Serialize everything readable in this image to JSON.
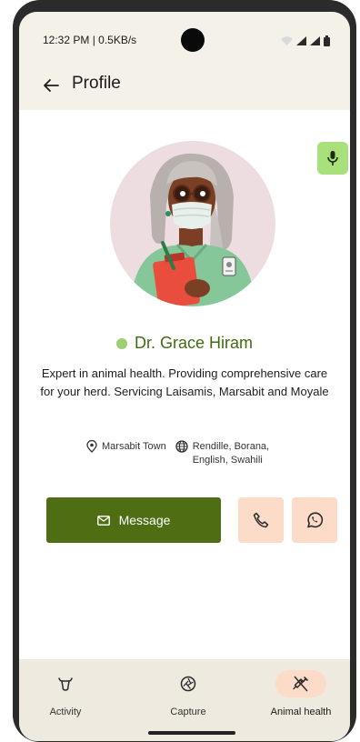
{
  "status_bar": {
    "time_speed": "12:32 PM | 0.5KB/s",
    "icons": [
      "wifi-icon",
      "signal-icon",
      "signal-icon",
      "battery-icon"
    ]
  },
  "app_bar": {
    "back_icon": "arrow-left-icon",
    "title": "Profile"
  },
  "profile": {
    "mic_icon": "microphone-icon",
    "avatar_icon": "doctor-avatar",
    "online_color": "#9ccf6f",
    "name": "Dr. Grace Hiram",
    "bio": "Expert in animal health. Providing comprehensive care for your herd. Servicing Laisamis, Marsabit and Moyale",
    "location_icon": "location-pin-icon",
    "location": "Marsabit Town",
    "language_icon": "globe-icon",
    "languages": "Rendille, Borana, English, Swahili"
  },
  "actions": {
    "message_icon": "mail-icon",
    "message_label": "Message",
    "call_icon": "phone-icon",
    "whatsapp_icon": "whatsapp-icon"
  },
  "bottom_nav": {
    "items": [
      {
        "label": "Activity",
        "icon": "cow-icon",
        "active": false
      },
      {
        "label": "Capture",
        "icon": "camera-shutter-icon",
        "active": false
      },
      {
        "label": "Animal health",
        "icon": "syringe-icon",
        "active": true
      }
    ]
  },
  "colors": {
    "accent_green": "#4f6d13",
    "name_green": "#3f6b12",
    "mic_green": "#a8e07b",
    "peach": "#fcdcc9",
    "header_bg": "#f4f1e8",
    "nav_bg": "#eeeae0"
  }
}
